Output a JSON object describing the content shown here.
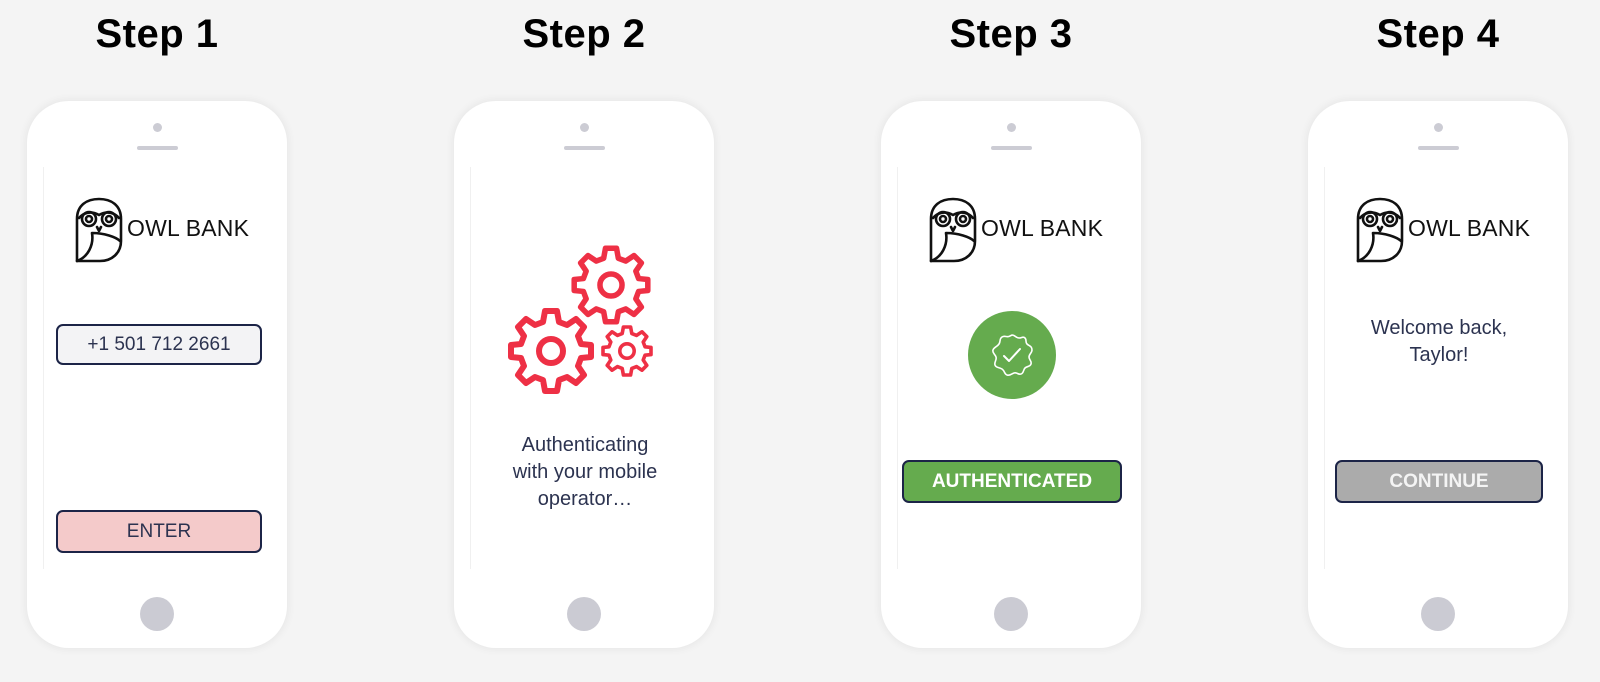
{
  "steps": [
    {
      "title": "Step 1",
      "brand": "OWL BANK",
      "phone_field": {
        "value": "+1 501 712 2661"
      },
      "button": {
        "label": "ENTER",
        "color": "#f4caca"
      }
    },
    {
      "title": "Step 2",
      "icon": "gears-icon",
      "accent": "#ee3045",
      "status_lines": [
        "Authenticating",
        "with your mobile",
        "operator…"
      ]
    },
    {
      "title": "Step 3",
      "brand": "OWL BANK",
      "icon": "verified-badge-icon",
      "button": {
        "label": "AUTHENTICATED",
        "color": "#65ab4e"
      }
    },
    {
      "title": "Step 4",
      "brand": "OWL BANK",
      "welcome_lines": [
        "Welcome back,",
        "Taylor!"
      ],
      "button": {
        "label": "CONTINUE",
        "color": "#ababab"
      }
    }
  ]
}
